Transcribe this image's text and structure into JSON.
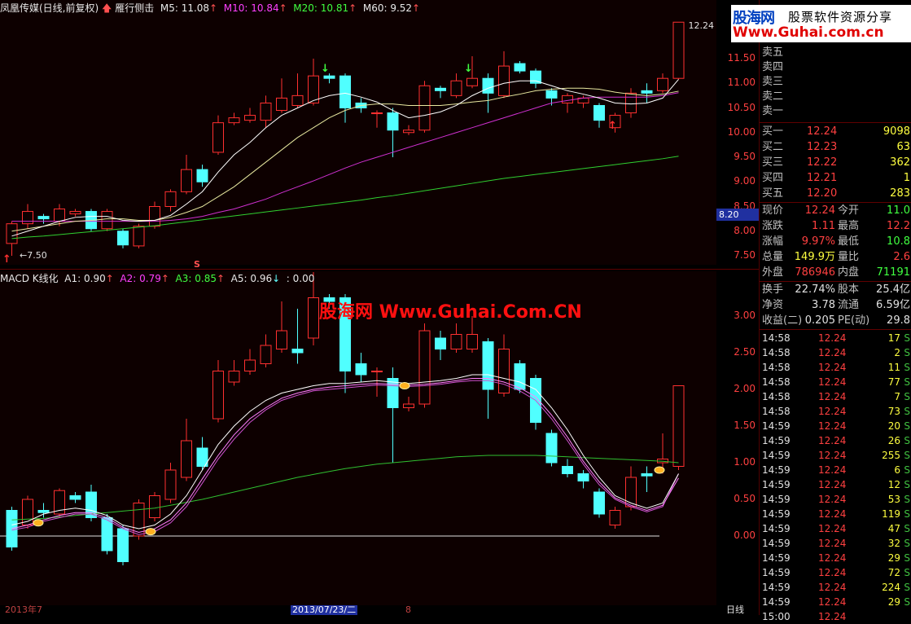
{
  "top": {
    "stock": "凤凰传媒(日线,前复权)",
    "formula": "雁行侧击",
    "m5": "M5: 11.08",
    "m10": "M10: 10.84",
    "m20": "M20: 10.81",
    "m60": "M60: 9.52",
    "high_label": "12.24",
    "low_label": "7.50",
    "price_tag": "8.20",
    "ticks": [
      "11.50",
      "11.00",
      "10.50",
      "10.00",
      "9.50",
      "9.00",
      "8.50",
      "8.00",
      "7.50"
    ]
  },
  "bottom": {
    "indicator": "MACD K线化",
    "a1": "A1: 0.90",
    "a2": "A2: 0.79",
    "a3": "A3: 0.85",
    "a5": "A5: 0.96",
    "extra": ": 0.00",
    "watermark": "股海网 Www.Guhai.Com.CN",
    "s_label": "S",
    "ticks": [
      "3.00",
      "2.50",
      "2.00",
      "1.50",
      "1.00",
      "0.50",
      "0.00"
    ]
  },
  "dates": {
    "d1": "2013年7",
    "d2": "2013/07/23/二",
    "d3": "8",
    "mode": "日线"
  },
  "logo": {
    "brand": "股海网",
    "slogan": "股票软件资源分享",
    "url": "Www.Guhai.com.cn"
  },
  "quote": {
    "sell": [
      "卖五",
      "卖四",
      "卖三",
      "卖二",
      "卖一"
    ],
    "buy": [
      {
        "l": "买一",
        "p": "12.24",
        "v": "9098"
      },
      {
        "l": "买二",
        "p": "12.23",
        "v": "63"
      },
      {
        "l": "买三",
        "p": "12.22",
        "v": "362"
      },
      {
        "l": "买四",
        "p": "12.21",
        "v": "1"
      },
      {
        "l": "买五",
        "p": "12.20",
        "v": "283"
      }
    ],
    "stats": [
      {
        "l1": "现价",
        "v1": "12.24",
        "l2": "今开",
        "v2": "11.0"
      },
      {
        "l1": "涨跌",
        "v1": "1.11",
        "l2": "最高",
        "v2": "12.2"
      },
      {
        "l1": "涨幅",
        "v1": "9.97%",
        "l2": "最低",
        "v2": "10.8"
      },
      {
        "l1": "总量",
        "v1": "149.9万",
        "l2": "量比",
        "v2": "2.6"
      },
      {
        "l1": "外盘",
        "v1": "786946",
        "l2": "内盘",
        "v2": "71191"
      }
    ],
    "fund": [
      {
        "l1": "换手",
        "v1": "22.74%",
        "l2": "股本",
        "v2": "25.4亿"
      },
      {
        "l1": "净资",
        "v1": "3.78",
        "l2": "流通",
        "v2": "6.59亿"
      },
      {
        "l1": "收益(二)",
        "v1": "0.205",
        "l2": "PE(动)",
        "v2": "29.8"
      }
    ]
  },
  "ticks_table": [
    {
      "t": "14:58",
      "p": "12.24",
      "v": "17",
      "s": "S"
    },
    {
      "t": "14:58",
      "p": "12.24",
      "v": "2",
      "s": "S"
    },
    {
      "t": "14:58",
      "p": "12.24",
      "v": "11",
      "s": "S"
    },
    {
      "t": "14:58",
      "p": "12.24",
      "v": "77",
      "s": "S"
    },
    {
      "t": "14:58",
      "p": "12.24",
      "v": "7",
      "s": "S"
    },
    {
      "t": "14:58",
      "p": "12.24",
      "v": "73",
      "s": "S"
    },
    {
      "t": "14:59",
      "p": "12.24",
      "v": "20",
      "s": "S"
    },
    {
      "t": "14:59",
      "p": "12.24",
      "v": "26",
      "s": "S"
    },
    {
      "t": "14:59",
      "p": "12.24",
      "v": "255",
      "s": "S"
    },
    {
      "t": "14:59",
      "p": "12.24",
      "v": "6",
      "s": "S"
    },
    {
      "t": "14:59",
      "p": "12.24",
      "v": "12",
      "s": "S"
    },
    {
      "t": "14:59",
      "p": "12.24",
      "v": "53",
      "s": "S"
    },
    {
      "t": "14:59",
      "p": "12.24",
      "v": "119",
      "s": "S"
    },
    {
      "t": "14:59",
      "p": "12.24",
      "v": "47",
      "s": "S"
    },
    {
      "t": "14:59",
      "p": "12.24",
      "v": "32",
      "s": "S"
    },
    {
      "t": "14:59",
      "p": "12.24",
      "v": "29",
      "s": "S"
    },
    {
      "t": "14:59",
      "p": "12.24",
      "v": "72",
      "s": "S"
    },
    {
      "t": "14:59",
      "p": "12.24",
      "v": "224",
      "s": "S"
    },
    {
      "t": "14:59",
      "p": "12.24",
      "v": "29",
      "s": "S"
    },
    {
      "t": "15:00",
      "p": "12.24",
      "v": "",
      "s": ""
    }
  ],
  "candles_top": [
    {
      "o": 7.75,
      "c": 8.15,
      "h": 8.2,
      "l": 7.5
    },
    {
      "o": 8.15,
      "c": 8.4,
      "h": 8.55,
      "l": 8.05
    },
    {
      "o": 8.3,
      "c": 8.25,
      "h": 8.35,
      "l": 8.15
    },
    {
      "o": 8.2,
      "c": 8.45,
      "h": 8.55,
      "l": 8.1
    },
    {
      "o": 8.35,
      "c": 8.4,
      "h": 8.45,
      "l": 8.3
    },
    {
      "o": 8.4,
      "c": 8.05,
      "h": 8.45,
      "l": 8.0
    },
    {
      "o": 8.05,
      "c": 8.4,
      "h": 8.45,
      "l": 8.0
    },
    {
      "o": 8.0,
      "c": 7.72,
      "h": 8.05,
      "l": 7.65
    },
    {
      "o": 7.7,
      "c": 8.1,
      "h": 8.15,
      "l": 7.65
    },
    {
      "o": 8.1,
      "c": 8.5,
      "h": 8.6,
      "l": 8.05
    },
    {
      "o": 8.5,
      "c": 8.8,
      "h": 8.85,
      "l": 8.4
    },
    {
      "o": 8.8,
      "c": 9.25,
      "h": 9.55,
      "l": 8.75
    },
    {
      "o": 9.25,
      "c": 9.0,
      "h": 9.35,
      "l": 8.9
    },
    {
      "o": 9.6,
      "c": 10.2,
      "h": 10.35,
      "l": 9.55
    },
    {
      "o": 10.2,
      "c": 10.3,
      "h": 10.4,
      "l": 10.15
    },
    {
      "o": 10.25,
      "c": 10.35,
      "h": 10.5,
      "l": 10.2
    },
    {
      "o": 10.25,
      "c": 10.6,
      "h": 10.75,
      "l": 10.1
    },
    {
      "o": 10.45,
      "c": 10.7,
      "h": 11.1,
      "l": 10.4
    },
    {
      "o": 10.55,
      "c": 10.75,
      "h": 11.2,
      "l": 10.5
    },
    {
      "o": 10.6,
      "c": 11.15,
      "h": 11.5,
      "l": 10.55
    },
    {
      "o": 11.15,
      "c": 11.1,
      "h": 11.2,
      "l": 11.0
    },
    {
      "o": 11.15,
      "c": 10.5,
      "h": 11.2,
      "l": 10.2
    },
    {
      "o": 10.6,
      "c": 10.5,
      "h": 10.7,
      "l": 10.4
    },
    {
      "o": 10.4,
      "c": 10.4,
      "h": 10.45,
      "l": 10.1
    },
    {
      "o": 10.4,
      "c": 10.05,
      "h": 10.5,
      "l": 9.5
    },
    {
      "o": 10.0,
      "c": 10.05,
      "h": 10.15,
      "l": 9.95
    },
    {
      "o": 10.05,
      "c": 10.95,
      "h": 11.05,
      "l": 10.0
    },
    {
      "o": 10.9,
      "c": 10.85,
      "h": 10.95,
      "l": 10.7
    },
    {
      "o": 10.75,
      "c": 11.05,
      "h": 11.2,
      "l": 10.7
    },
    {
      "o": 10.95,
      "c": 11.1,
      "h": 11.55,
      "l": 10.9
    },
    {
      "o": 11.1,
      "c": 10.8,
      "h": 11.2,
      "l": 10.4
    },
    {
      "o": 10.75,
      "c": 11.35,
      "h": 11.65,
      "l": 10.7
    },
    {
      "o": 11.4,
      "c": 11.25,
      "h": 11.45,
      "l": 11.2
    },
    {
      "o": 11.25,
      "c": 11.0,
      "h": 11.3,
      "l": 10.9
    },
    {
      "o": 10.85,
      "c": 10.7,
      "h": 10.9,
      "l": 10.55
    },
    {
      "o": 10.6,
      "c": 10.75,
      "h": 10.8,
      "l": 10.4
    },
    {
      "o": 10.6,
      "c": 10.7,
      "h": 10.75,
      "l": 10.5
    },
    {
      "o": 10.55,
      "c": 10.25,
      "h": 10.6,
      "l": 10.1
    },
    {
      "o": 10.1,
      "c": 10.35,
      "h": 10.4,
      "l": 10.0
    },
    {
      "o": 10.4,
      "c": 10.8,
      "h": 10.9,
      "l": 10.3
    },
    {
      "o": 10.85,
      "c": 10.8,
      "h": 11.0,
      "l": 10.6
    },
    {
      "o": 10.85,
      "c": 11.1,
      "h": 11.2,
      "l": 10.8
    },
    {
      "o": 11.1,
      "c": 12.24,
      "h": 12.24,
      "l": 11.08
    }
  ],
  "candles_bot": [
    {
      "o": 0.35,
      "c": -0.15,
      "h": 0.4,
      "l": -0.2
    },
    {
      "o": 0.15,
      "c": 0.5,
      "h": 0.55,
      "l": 0.1
    },
    {
      "o": 0.35,
      "c": 0.32,
      "h": 0.45,
      "l": 0.25
    },
    {
      "o": 0.3,
      "c": 0.62,
      "h": 0.65,
      "l": 0.25
    },
    {
      "o": 0.55,
      "c": 0.5,
      "h": 0.6,
      "l": 0.45
    },
    {
      "o": 0.6,
      "c": 0.25,
      "h": 0.7,
      "l": 0.2
    },
    {
      "o": 0.25,
      "c": -0.2,
      "h": 0.3,
      "l": -0.25
    },
    {
      "o": 0.1,
      "c": -0.35,
      "h": 0.15,
      "l": -0.4
    },
    {
      "o": 0.0,
      "c": 0.45,
      "h": 0.5,
      "l": -0.05
    },
    {
      "o": 0.25,
      "c": 0.55,
      "h": 0.6,
      "l": 0.2
    },
    {
      "o": 0.5,
      "c": 0.9,
      "h": 1.0,
      "l": 0.45
    },
    {
      "o": 0.8,
      "c": 1.3,
      "h": 1.6,
      "l": 0.75
    },
    {
      "o": 1.2,
      "c": 0.95,
      "h": 1.35,
      "l": 0.9
    },
    {
      "o": 1.6,
      "c": 2.25,
      "h": 2.4,
      "l": 1.55
    },
    {
      "o": 2.1,
      "c": 2.25,
      "h": 2.4,
      "l": 2.05
    },
    {
      "o": 2.25,
      "c": 2.4,
      "h": 2.55,
      "l": 2.2
    },
    {
      "o": 2.35,
      "c": 2.6,
      "h": 2.75,
      "l": 2.3
    },
    {
      "o": 2.55,
      "c": 2.8,
      "h": 3.2,
      "l": 2.5
    },
    {
      "o": 2.55,
      "c": 2.5,
      "h": 3.1,
      "l": 2.35
    },
    {
      "o": 2.7,
      "c": 3.25,
      "h": 3.6,
      "l": 2.6
    },
    {
      "o": 3.25,
      "c": 3.2,
      "h": 3.3,
      "l": 3.1
    },
    {
      "o": 3.25,
      "c": 2.25,
      "h": 3.3,
      "l": 1.95
    },
    {
      "o": 2.35,
      "c": 2.2,
      "h": 2.5,
      "l": 2.1
    },
    {
      "o": 2.25,
      "c": 2.25,
      "h": 2.3,
      "l": 1.9
    },
    {
      "o": 2.15,
      "c": 1.75,
      "h": 2.3,
      "l": 1.0
    },
    {
      "o": 1.75,
      "c": 1.8,
      "h": 1.9,
      "l": 1.7
    },
    {
      "o": 1.8,
      "c": 2.8,
      "h": 2.9,
      "l": 1.75
    },
    {
      "o": 2.7,
      "c": 2.55,
      "h": 2.8,
      "l": 2.4
    },
    {
      "o": 2.55,
      "c": 2.75,
      "h": 2.9,
      "l": 2.5
    },
    {
      "o": 2.55,
      "c": 2.75,
      "h": 3.0,
      "l": 2.5
    },
    {
      "o": 2.65,
      "c": 2.0,
      "h": 2.7,
      "l": 1.6
    },
    {
      "o": 1.95,
      "c": 2.55,
      "h": 2.75,
      "l": 1.9
    },
    {
      "o": 2.35,
      "c": 2.0,
      "h": 2.4,
      "l": 1.95
    },
    {
      "o": 2.15,
      "c": 1.55,
      "h": 2.2,
      "l": 1.45
    },
    {
      "o": 1.4,
      "c": 1.0,
      "h": 1.45,
      "l": 0.95
    },
    {
      "o": 0.95,
      "c": 0.85,
      "h": 1.05,
      "l": 0.8
    },
    {
      "o": 0.85,
      "c": 0.75,
      "h": 0.9,
      "l": 0.65
    },
    {
      "o": 0.6,
      "c": 0.3,
      "h": 0.65,
      "l": 0.25
    },
    {
      "o": 0.15,
      "c": 0.35,
      "h": 0.4,
      "l": 0.1
    },
    {
      "o": 0.4,
      "c": 0.8,
      "h": 0.95,
      "l": 0.35
    },
    {
      "o": 0.85,
      "c": 0.82,
      "h": 0.95,
      "l": 0.6
    },
    {
      "o": 1.0,
      "c": 1.05,
      "h": 1.4,
      "l": 0.85
    },
    {
      "o": 0.95,
      "c": 2.05,
      "h": 2.05,
      "l": 0.9
    }
  ],
  "ma_top": {
    "m5": [
      7.9,
      8.0,
      8.1,
      8.2,
      8.28,
      8.3,
      8.3,
      8.22,
      8.2,
      8.22,
      8.32,
      8.55,
      8.8,
      9.2,
      9.55,
      9.8,
      10.1,
      10.35,
      10.5,
      10.65,
      10.75,
      10.8,
      10.72,
      10.62,
      10.45,
      10.3,
      10.35,
      10.42,
      10.55,
      10.75,
      10.9,
      11.0,
      11.05,
      11.05,
      10.95,
      10.85,
      10.78,
      10.7,
      10.6,
      10.58,
      10.6,
      10.7,
      11.08
    ],
    "m10": [
      8.0,
      8.05,
      8.1,
      8.15,
      8.2,
      8.22,
      8.25,
      8.25,
      8.22,
      8.22,
      8.28,
      8.38,
      8.5,
      8.7,
      8.9,
      9.15,
      9.4,
      9.65,
      9.9,
      10.1,
      10.3,
      10.45,
      10.55,
      10.58,
      10.58,
      10.55,
      10.55,
      10.55,
      10.58,
      10.62,
      10.65,
      10.72,
      10.78,
      10.85,
      10.88,
      10.9,
      10.9,
      10.88,
      10.82,
      10.78,
      10.75,
      10.78,
      10.84
    ],
    "m20": [
      8.2,
      8.2,
      8.2,
      8.2,
      8.2,
      8.2,
      8.2,
      8.2,
      8.2,
      8.2,
      8.22,
      8.25,
      8.3,
      8.38,
      8.45,
      8.55,
      8.65,
      8.78,
      8.9,
      9.02,
      9.15,
      9.28,
      9.4,
      9.5,
      9.6,
      9.7,
      9.8,
      9.9,
      10.0,
      10.1,
      10.2,
      10.3,
      10.4,
      10.5,
      10.6,
      10.65,
      10.7,
      10.72,
      10.72,
      10.72,
      10.72,
      10.75,
      10.81
    ],
    "m60": [
      7.85,
      7.88,
      7.9,
      7.93,
      7.96,
      7.99,
      8.02,
      8.05,
      8.08,
      8.11,
      8.15,
      8.19,
      8.23,
      8.27,
      8.31,
      8.35,
      8.39,
      8.43,
      8.47,
      8.51,
      8.55,
      8.59,
      8.63,
      8.68,
      8.72,
      8.77,
      8.82,
      8.87,
      8.92,
      8.97,
      9.02,
      9.07,
      9.11,
      9.15,
      9.19,
      9.23,
      9.27,
      9.31,
      9.35,
      9.39,
      9.43,
      9.47,
      9.52
    ]
  },
  "ma_bot": {
    "w": [
      0.15,
      0.2,
      0.3,
      0.35,
      0.38,
      0.35,
      0.28,
      0.15,
      0.1,
      0.15,
      0.3,
      0.55,
      0.9,
      1.25,
      1.5,
      1.7,
      1.85,
      1.95,
      2.0,
      2.05,
      2.08,
      2.08,
      2.1,
      2.12,
      2.1,
      2.08,
      2.1,
      2.12,
      2.15,
      2.2,
      2.2,
      2.15,
      2.1,
      2.0,
      1.75,
      1.45,
      1.1,
      0.8,
      0.55,
      0.45,
      0.38,
      0.45,
      0.85
    ],
    "p": [
      0.1,
      0.15,
      0.22,
      0.28,
      0.32,
      0.32,
      0.25,
      0.12,
      0.05,
      0.1,
      0.22,
      0.45,
      0.78,
      1.1,
      1.38,
      1.6,
      1.75,
      1.88,
      1.95,
      2.0,
      2.03,
      2.05,
      2.07,
      2.08,
      2.07,
      2.06,
      2.07,
      2.09,
      2.12,
      2.15,
      2.15,
      2.1,
      2.02,
      1.9,
      1.65,
      1.35,
      1.02,
      0.74,
      0.52,
      0.42,
      0.35,
      0.42,
      0.79
    ],
    "pk": [
      0.08,
      0.12,
      0.2,
      0.25,
      0.3,
      0.3,
      0.22,
      0.1,
      0.02,
      0.06,
      0.18,
      0.4,
      0.72,
      1.05,
      1.32,
      1.55,
      1.72,
      1.85,
      1.92,
      1.98,
      2.0,
      2.02,
      2.04,
      2.06,
      2.05,
      2.04,
      2.05,
      2.07,
      2.1,
      2.12,
      2.12,
      2.07,
      1.98,
      1.85,
      1.6,
      1.3,
      0.98,
      0.7,
      0.5,
      0.4,
      0.33,
      0.4,
      0.85
    ],
    "gr": [
      0.22,
      0.23,
      0.24,
      0.26,
      0.28,
      0.3,
      0.32,
      0.34,
      0.36,
      0.38,
      0.42,
      0.46,
      0.5,
      0.55,
      0.6,
      0.65,
      0.7,
      0.75,
      0.8,
      0.84,
      0.88,
      0.92,
      0.95,
      0.98,
      1.0,
      1.02,
      1.04,
      1.06,
      1.08,
      1.09,
      1.1,
      1.1,
      1.1,
      1.1,
      1.09,
      1.08,
      1.07,
      1.06,
      1.05,
      1.04,
      1.03,
      1.02,
      1.0
    ]
  }
}
